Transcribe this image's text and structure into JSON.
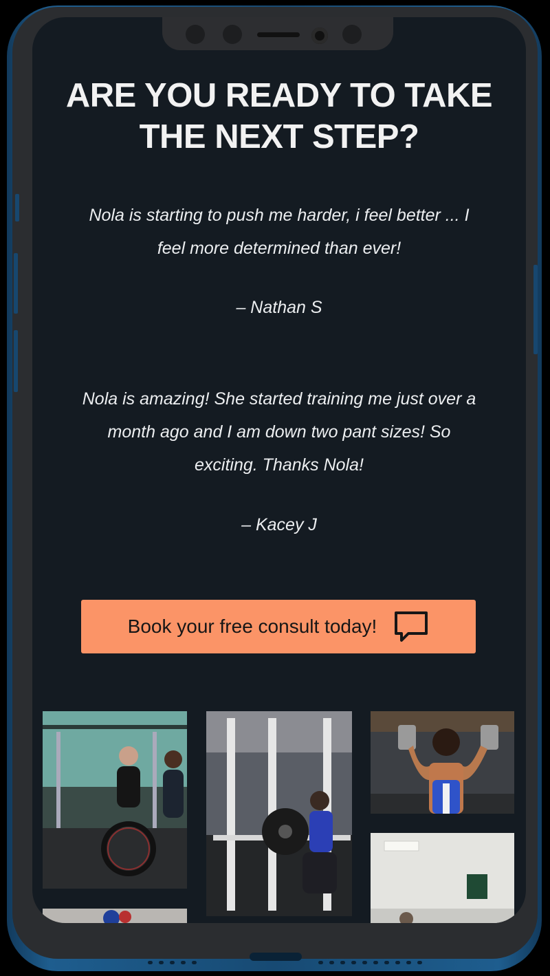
{
  "hero": {
    "headline_line1": "ARE YOU READY TO TAKE",
    "headline_line2": "THE NEXT STEP?"
  },
  "testimonials": [
    {
      "line1": "Nola is starting to push me harder, i feel better ... I",
      "line2": "feel more determined than ever!",
      "author": "– Nathan S"
    },
    {
      "line1": "Nola is amazing! She started training me just over a",
      "line2": "month ago and I am down two pant sizes! So",
      "line3": "exciting. Thanks Nola!",
      "author": "– Kacey J"
    }
  ],
  "cta": {
    "label": "Book your free consult today!",
    "icon": "chat-bubble-icon",
    "color": "#fb9467"
  },
  "gallery": {
    "photos": [
      {
        "name": "wheelchair-training-photo"
      },
      {
        "name": "squat-rack-photo"
      },
      {
        "name": "shoulder-press-photo"
      },
      {
        "name": "gym-ceiling-photo"
      },
      {
        "name": "boxing-photo"
      }
    ]
  },
  "colors": {
    "page_background": "#141b22",
    "text": "#eceef0",
    "phone_frame": "#1e5d8e"
  }
}
